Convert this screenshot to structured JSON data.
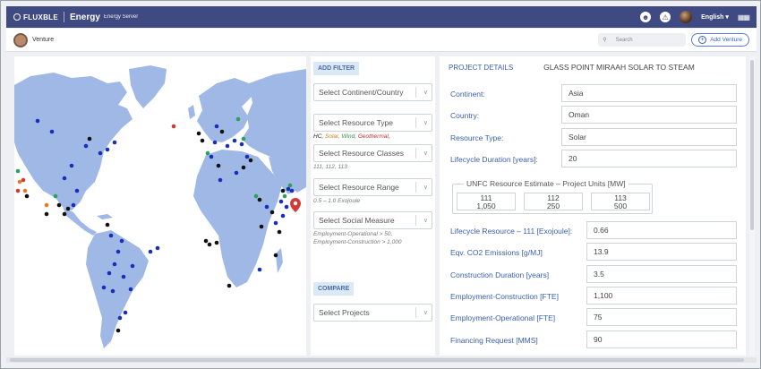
{
  "topbar": {
    "brand": "FLUXBLE",
    "product": "Energy",
    "product_sub": "Energy Server",
    "language": "English",
    "language_caret": "▾",
    "grid_icon": "apps-grid-icon"
  },
  "subbar": {
    "workspace": "Venture",
    "search_placeholder": "Search",
    "add_button": "Add Venture"
  },
  "filters": {
    "add_filter": "ADD FILTER",
    "continent": "Select Continent/Country",
    "resource_type": "Select Resource Type",
    "resource_type_hint": {
      "hc": "HC,",
      "solar": "Solar,",
      "wind": "Wind,",
      "geothermal": "Geothermal,"
    },
    "resource_classes": "Select Resource Classes",
    "resource_classes_hint": "111, 112, 113",
    "resource_range": "Select Resource Range",
    "resource_range_hint": "0.5 – 1.0 Exojoule",
    "social_measure": "Select Social Measure",
    "social_measure_hint_1": "Employment-Operational > 50,",
    "social_measure_hint_2": "Employment-Construction > 1,000",
    "compare": "COMPARE",
    "projects": "Select Projects"
  },
  "details": {
    "header": "PROJECT DETAILS",
    "project_name": "GLASS POINT MIRAAH SOLAR TO STEAM",
    "continent_label": "Continent:",
    "continent": "Asia",
    "country_label": "Country:",
    "country": "Oman",
    "resource_type_label": "Resource Type:",
    "resource_type": "Solar",
    "lifecycle_label": "Lifecycle Duration [years]:",
    "lifecycle": "20",
    "unfc_title": "UNFC Resource Estimate – Project Units [MW]",
    "unfc": [
      {
        "code": "111",
        "value": "1,050"
      },
      {
        "code": "112",
        "value": "250"
      },
      {
        "code": "113",
        "value": "500"
      }
    ],
    "lifecycle_resource_label": "Lifecycle Resource – 111 [Exojoule]:",
    "lifecycle_resource": "0.66",
    "co2_label": "Eqv. CO2 Emissions [g/MJ]",
    "co2": "13.9",
    "construction_label": "Construction Duration [years]",
    "construction": "3.5",
    "emp_construction_label": "Employment-Construction [FTE]",
    "emp_construction": "1,100",
    "emp_operational_label": "Employment-Operational [FTE]",
    "emp_operational": "75",
    "financing_label": "Financing Request [MMS]",
    "financing": "90"
  },
  "colors": {
    "hc": "#111111",
    "solar": "#e07b2a",
    "wind": "#2aa05a",
    "geothermal": "#d23a3a",
    "project": "#1a2fb8",
    "land": "#9fb8e6",
    "accent": "#3f4a82"
  }
}
